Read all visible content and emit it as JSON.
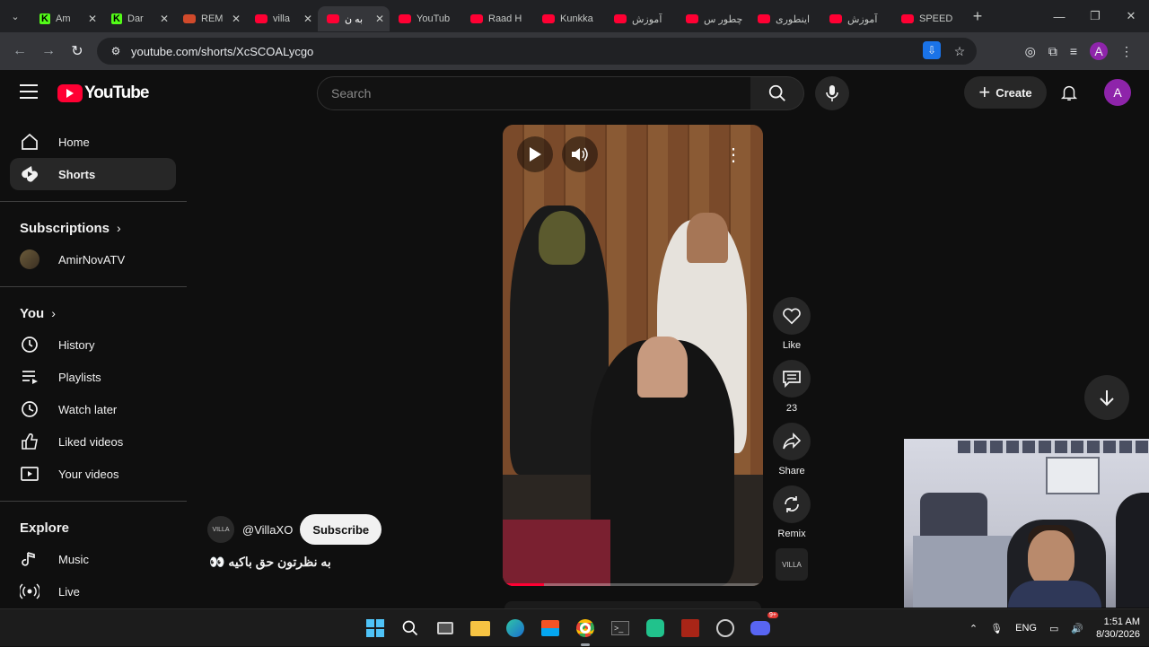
{
  "browser": {
    "tabs": [
      {
        "title": "Am",
        "fav": "k"
      },
      {
        "title": "Dar",
        "fav": "k"
      },
      {
        "title": "REM",
        "fav": "rem"
      },
      {
        "title": "villa",
        "fav": "yt"
      },
      {
        "title": "به ن",
        "fav": "yt",
        "active": true
      },
      {
        "title": "YouTub",
        "fav": "yt"
      },
      {
        "title": "Raad H",
        "fav": "yt"
      },
      {
        "title": "Kunkka",
        "fav": "yt"
      },
      {
        "title": "آموزش",
        "fav": "yt"
      },
      {
        "title": "چطور س",
        "fav": "yt"
      },
      {
        "title": "اینطوری",
        "fav": "yt"
      },
      {
        "title": "آموزش",
        "fav": "yt"
      },
      {
        "title": "SPEED",
        "fav": "yt"
      }
    ],
    "url": "youtube.com/shorts/XcSCOALycgo",
    "profile_initial": "A"
  },
  "header": {
    "logo_text": "YouTube",
    "search_placeholder": "Search",
    "create_label": "Create",
    "avatar_initial": "A"
  },
  "sidebar": {
    "main": [
      {
        "label": "Home",
        "icon": "home-icon"
      },
      {
        "label": "Shorts",
        "icon": "shorts-icon",
        "selected": true
      }
    ],
    "subscriptions_title": "Subscriptions",
    "subscriptions": [
      {
        "label": "AmirNovATV"
      }
    ],
    "you_title": "You",
    "you": [
      {
        "label": "History",
        "icon": "history-icon"
      },
      {
        "label": "Playlists",
        "icon": "playlists-icon"
      },
      {
        "label": "Watch later",
        "icon": "watch-later-icon"
      },
      {
        "label": "Liked videos",
        "icon": "liked-videos-icon"
      },
      {
        "label": "Your videos",
        "icon": "your-videos-icon"
      }
    ],
    "explore_title": "Explore",
    "explore": [
      {
        "label": "Music",
        "icon": "music-icon"
      },
      {
        "label": "Live",
        "icon": "live-icon"
      }
    ]
  },
  "short": {
    "channel_name": "@VillaXO",
    "channel_avatar_text": "VILLA",
    "subscribe_label": "Subscribe",
    "caption": "به نظرتون حق باکیه 👀",
    "progress": 0.16,
    "actions": {
      "like_label": "Like",
      "comments_count": "23",
      "share_label": "Share",
      "remix_label": "Remix",
      "remix_thumb_text": "VILLA"
    }
  },
  "taskbar": {
    "language": "ENG",
    "time": "1:51 AM",
    "date": "8/30/2026",
    "discord_badge": "9+"
  }
}
